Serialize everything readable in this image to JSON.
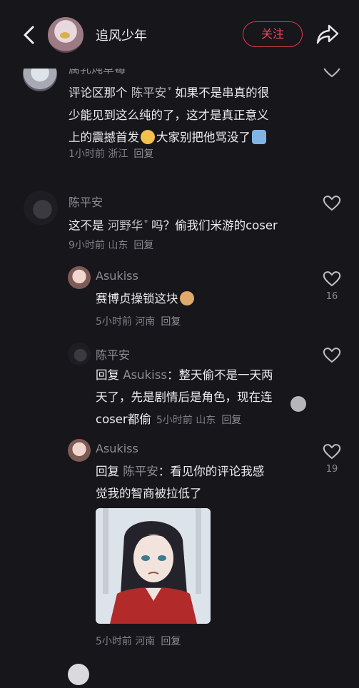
{
  "header": {
    "title": "追风少年",
    "follow_label": "关注"
  },
  "comments": [
    {
      "username": "腐乳炖草莓",
      "text_line1_pre": "评论区那个 ",
      "text_line1_mention": "陈平安",
      "text_line1_post": " 如果不是串真的很",
      "text_line2": "少能见到这么纯的了，这才是真正意义",
      "text_line3_a": "上的震撼首发",
      "text_line3_b": "大家别把他骂没了",
      "time": "1小时前 浙江",
      "reply": "回复"
    },
    {
      "username": "陈平安",
      "text_pre": "这不是 ",
      "text_mention": "河野华",
      "text_post": " 吗？偷我们米游的coser",
      "time": "9小时前 山东",
      "reply": "回复"
    },
    {
      "username": "Asukiss",
      "text": "赛博贞操锁这块",
      "time": "5小时前 河南",
      "reply": "回复",
      "likes": "16"
    },
    {
      "username": "陈平安",
      "reply_prefix": "回复 ",
      "reply_to": "Asukiss",
      "line1": "：整天偷不是一天两",
      "line2": "天了，先是剧情后是角色，现在连",
      "line3": "coser都偷",
      "time": "5小时前 山东",
      "reply": "回复"
    },
    {
      "username": "Asukiss",
      "reply_prefix": "回复 ",
      "reply_to": "陈平安",
      "line1": "：看见你的评论我感",
      "line2": "觉我的智商被拉低了",
      "time": "5小时前 河南",
      "reply": "回复",
      "likes": "19"
    }
  ],
  "colors": {
    "background": "#16161b",
    "accent": "#e23b4b"
  }
}
